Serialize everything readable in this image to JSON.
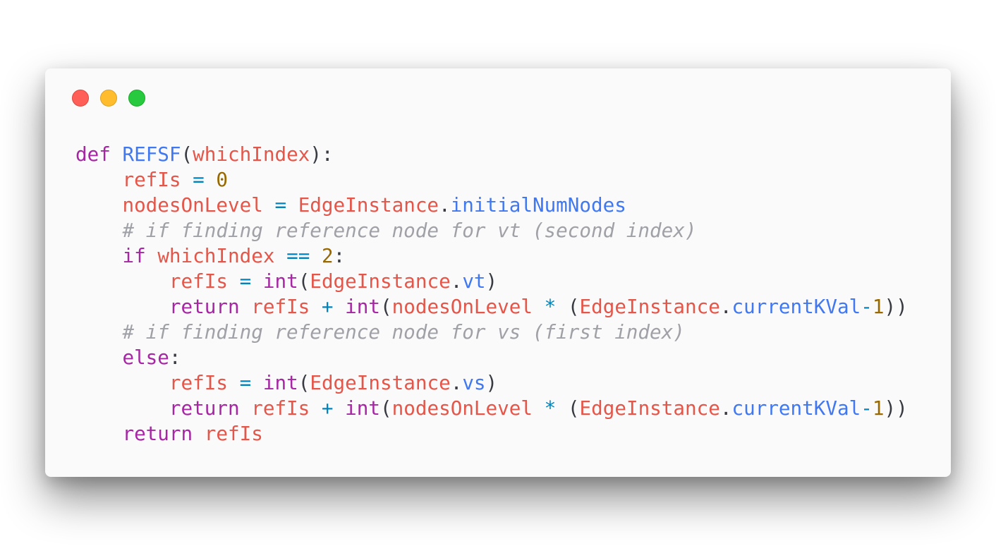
{
  "window": {
    "buttons": [
      {
        "name": "close",
        "color": "#ff5f56"
      },
      {
        "name": "minimize",
        "color": "#ffbd2e"
      },
      {
        "name": "maximize",
        "color": "#27c93f"
      }
    ]
  },
  "code": {
    "language": "python",
    "lines": [
      [
        [
          "keyword",
          "def"
        ],
        [
          "plain",
          " "
        ],
        [
          "func",
          "REFSF"
        ],
        [
          "punc",
          "("
        ],
        [
          "param",
          "whichIndex"
        ],
        [
          "punc",
          "):"
        ]
      ],
      [
        [
          "plain",
          "    "
        ],
        [
          "var",
          "refIs"
        ],
        [
          "plain",
          " "
        ],
        [
          "op",
          "="
        ],
        [
          "plain",
          " "
        ],
        [
          "num",
          "0"
        ]
      ],
      [
        [
          "plain",
          "    "
        ],
        [
          "var",
          "nodesOnLevel"
        ],
        [
          "plain",
          " "
        ],
        [
          "op",
          "="
        ],
        [
          "plain",
          " "
        ],
        [
          "var",
          "EdgeInstance"
        ],
        [
          "punc",
          "."
        ],
        [
          "attr",
          "initialNumNodes"
        ]
      ],
      [
        [
          "plain",
          "    "
        ],
        [
          "comment",
          "# if finding reference node for vt (second index)"
        ]
      ],
      [
        [
          "plain",
          "    "
        ],
        [
          "keyword",
          "if"
        ],
        [
          "plain",
          " "
        ],
        [
          "var",
          "whichIndex"
        ],
        [
          "plain",
          " "
        ],
        [
          "op",
          "=="
        ],
        [
          "plain",
          " "
        ],
        [
          "num",
          "2"
        ],
        [
          "punc",
          ":"
        ]
      ],
      [
        [
          "plain",
          "        "
        ],
        [
          "var",
          "refIs"
        ],
        [
          "plain",
          " "
        ],
        [
          "op",
          "="
        ],
        [
          "plain",
          " "
        ],
        [
          "builtin",
          "int"
        ],
        [
          "punc",
          "("
        ],
        [
          "var",
          "EdgeInstance"
        ],
        [
          "punc",
          "."
        ],
        [
          "attr",
          "vt"
        ],
        [
          "punc",
          ")"
        ]
      ],
      [
        [
          "plain",
          "        "
        ],
        [
          "keyword",
          "return"
        ],
        [
          "plain",
          " "
        ],
        [
          "var",
          "refIs"
        ],
        [
          "plain",
          " "
        ],
        [
          "op",
          "+"
        ],
        [
          "plain",
          " "
        ],
        [
          "builtin",
          "int"
        ],
        [
          "punc",
          "("
        ],
        [
          "var",
          "nodesOnLevel"
        ],
        [
          "plain",
          " "
        ],
        [
          "op",
          "*"
        ],
        [
          "plain",
          " "
        ],
        [
          "punc",
          "("
        ],
        [
          "var",
          "EdgeInstance"
        ],
        [
          "punc",
          "."
        ],
        [
          "attr",
          "currentKVal"
        ],
        [
          "op",
          "-"
        ],
        [
          "num",
          "1"
        ],
        [
          "punc",
          "))"
        ]
      ],
      [
        [
          "plain",
          "    "
        ],
        [
          "comment",
          "# if finding reference node for vs (first index)"
        ]
      ],
      [
        [
          "plain",
          "    "
        ],
        [
          "keyword",
          "else"
        ],
        [
          "punc",
          ":"
        ]
      ],
      [
        [
          "plain",
          "        "
        ],
        [
          "var",
          "refIs"
        ],
        [
          "plain",
          " "
        ],
        [
          "op",
          "="
        ],
        [
          "plain",
          " "
        ],
        [
          "builtin",
          "int"
        ],
        [
          "punc",
          "("
        ],
        [
          "var",
          "EdgeInstance"
        ],
        [
          "punc",
          "."
        ],
        [
          "attr",
          "vs"
        ],
        [
          "punc",
          ")"
        ]
      ],
      [
        [
          "plain",
          "        "
        ],
        [
          "keyword",
          "return"
        ],
        [
          "plain",
          " "
        ],
        [
          "var",
          "refIs"
        ],
        [
          "plain",
          " "
        ],
        [
          "op",
          "+"
        ],
        [
          "plain",
          " "
        ],
        [
          "builtin",
          "int"
        ],
        [
          "punc",
          "("
        ],
        [
          "var",
          "nodesOnLevel"
        ],
        [
          "plain",
          " "
        ],
        [
          "op",
          "*"
        ],
        [
          "plain",
          " "
        ],
        [
          "punc",
          "("
        ],
        [
          "var",
          "EdgeInstance"
        ],
        [
          "punc",
          "."
        ],
        [
          "attr",
          "currentKVal"
        ],
        [
          "op",
          "-"
        ],
        [
          "num",
          "1"
        ],
        [
          "punc",
          "))"
        ]
      ],
      [
        [
          "plain",
          "    "
        ],
        [
          "keyword",
          "return"
        ],
        [
          "plain",
          " "
        ],
        [
          "var",
          "refIs"
        ]
      ]
    ]
  }
}
